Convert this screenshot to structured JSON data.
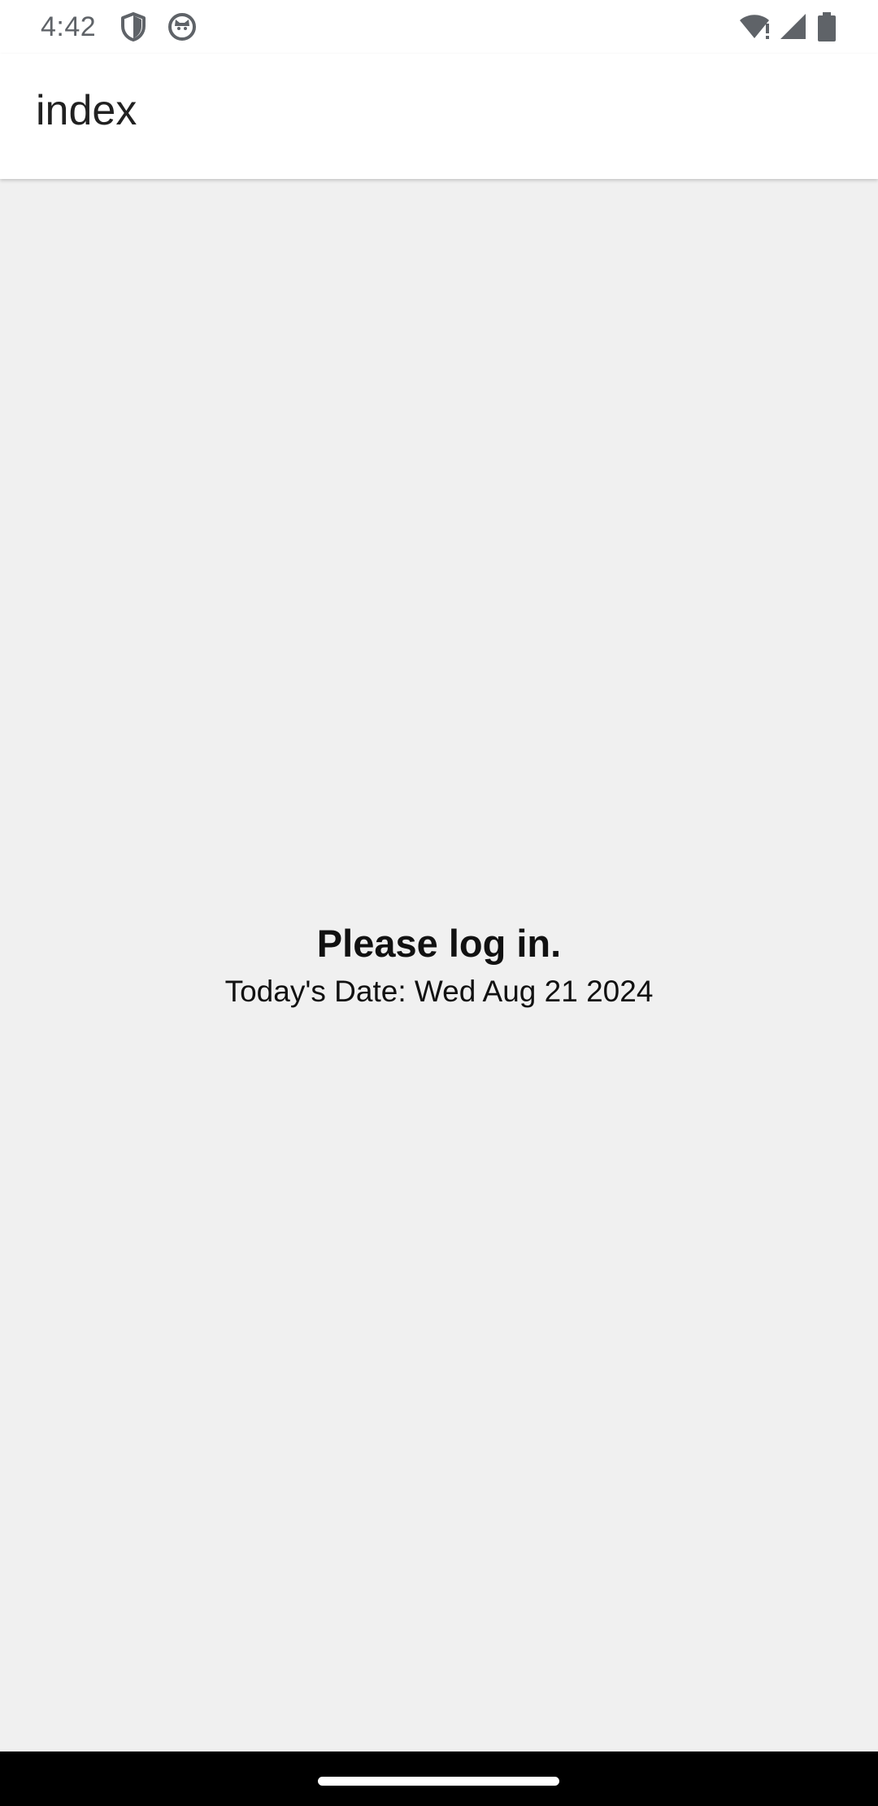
{
  "status_bar": {
    "time": "4:42",
    "left_icons": [
      "shield-icon",
      "cat-face-icon"
    ],
    "right_icons": [
      "wifi-alert-icon",
      "cell-signal-icon",
      "battery-icon"
    ],
    "icon_color": "#5f6368"
  },
  "app_bar": {
    "title": "index"
  },
  "main": {
    "heading": "Please log in.",
    "date_label": "Today's Date:",
    "date_value": "Wed Aug 21 2024"
  },
  "nav_bar": {
    "handle": "home-handle"
  },
  "colors": {
    "background": "#f0f0f0",
    "app_bar": "#ffffff",
    "text": "#111111",
    "nav_bar": "#000000"
  }
}
